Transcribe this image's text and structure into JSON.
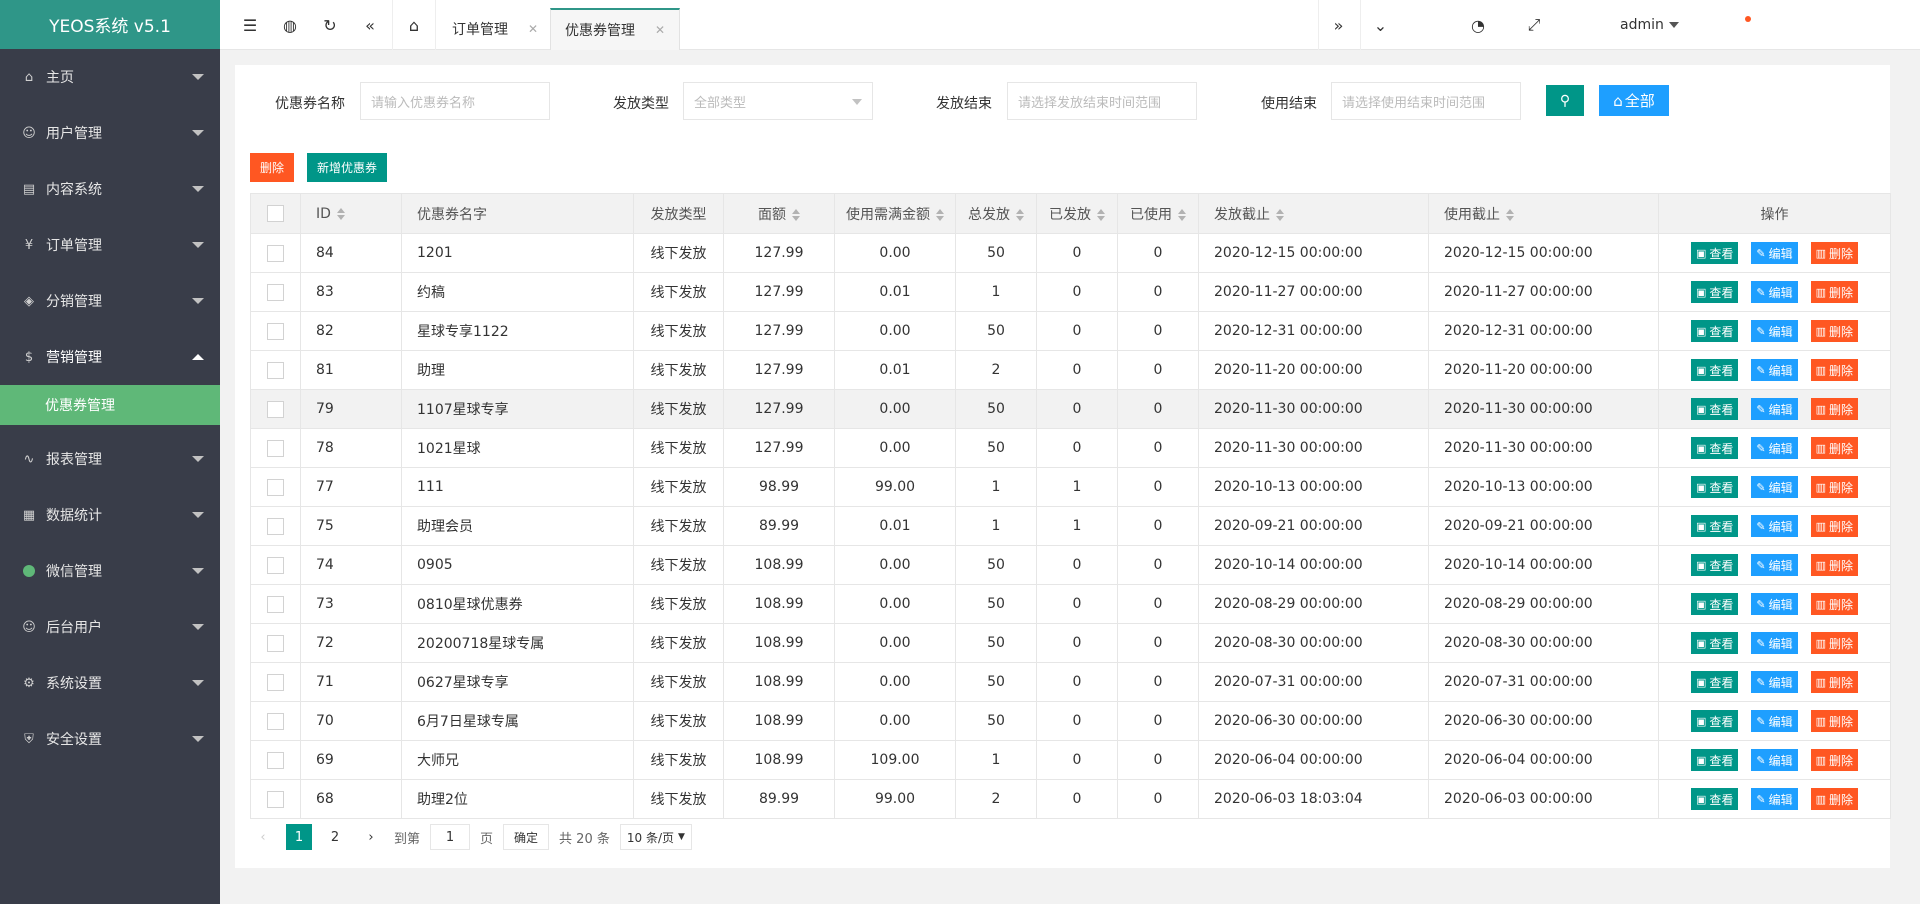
{
  "app": {
    "title": "YEOS系统 v5.1"
  },
  "sidebar": {
    "items": [
      {
        "label": "主页",
        "icon": "home-icon"
      },
      {
        "label": "用户管理",
        "icon": "user-icon"
      },
      {
        "label": "内容系统",
        "icon": "content-icon"
      },
      {
        "label": "订单管理",
        "icon": "yen-icon"
      },
      {
        "label": "分销管理",
        "icon": "cube-icon"
      },
      {
        "label": "营销管理",
        "icon": "dollar-icon"
      },
      {
        "label": "报表管理",
        "icon": "pulse-icon"
      },
      {
        "label": "数据统计",
        "icon": "table-icon"
      },
      {
        "label": "微信管理",
        "icon": "wechat-icon"
      },
      {
        "label": "后台用户",
        "icon": "admin-user-icon"
      },
      {
        "label": "系统设置",
        "icon": "gear-icon"
      },
      {
        "label": "安全设置",
        "icon": "shield-icon"
      }
    ],
    "sub_active": "优惠券管理"
  },
  "header": {
    "tabs": [
      {
        "label": "订单管理"
      },
      {
        "label": "优惠券管理"
      }
    ],
    "user": "admin"
  },
  "filters": {
    "name_label": "优惠券名称",
    "name_placeholder": "请输入优惠券名称",
    "type_label": "发放类型",
    "type_value": "全部类型",
    "issue_end_label": "发放结束",
    "issue_end_placeholder": "请选择发放结束时间范围",
    "use_end_label": "使用结束",
    "use_end_placeholder": "请选择使用结束时间范围",
    "all_label": "全部"
  },
  "actions": {
    "delete": "删除",
    "add": "新增优惠券"
  },
  "table": {
    "headers": [
      "ID",
      "优惠券名字",
      "发放类型",
      "面额",
      "使用需满金额",
      "总发放",
      "已发放",
      "已使用",
      "发放截止",
      "使用截止",
      "操作"
    ],
    "row_actions": {
      "view": "查看",
      "edit": "编辑",
      "delete": "删除"
    },
    "rows": [
      [
        "84",
        "1201",
        "线下发放",
        "127.99",
        "0.00",
        "50",
        "0",
        "0",
        "2020-12-15 00:00:00",
        "2020-12-15 00:00:00"
      ],
      [
        "83",
        "约稿",
        "线下发放",
        "127.99",
        "0.01",
        "1",
        "0",
        "0",
        "2020-11-27 00:00:00",
        "2020-11-27 00:00:00"
      ],
      [
        "82",
        "星球专享1122",
        "线下发放",
        "127.99",
        "0.00",
        "50",
        "0",
        "0",
        "2020-12-31 00:00:00",
        "2020-12-31 00:00:00"
      ],
      [
        "81",
        "助理",
        "线下发放",
        "127.99",
        "0.01",
        "2",
        "0",
        "0",
        "2020-11-20 00:00:00",
        "2020-11-20 00:00:00"
      ],
      [
        "79",
        "1107星球专享",
        "线下发放",
        "127.99",
        "0.00",
        "50",
        "0",
        "0",
        "2020-11-30 00:00:00",
        "2020-11-30 00:00:00"
      ],
      [
        "78",
        "1021星球",
        "线下发放",
        "127.99",
        "0.00",
        "50",
        "0",
        "0",
        "2020-11-30 00:00:00",
        "2020-11-30 00:00:00"
      ],
      [
        "77",
        "111",
        "线下发放",
        "98.99",
        "99.00",
        "1",
        "1",
        "0",
        "2020-10-13 00:00:00",
        "2020-10-13 00:00:00"
      ],
      [
        "75",
        "助理会员",
        "线下发放",
        "89.99",
        "0.01",
        "1",
        "1",
        "0",
        "2020-09-21 00:00:00",
        "2020-09-21 00:00:00"
      ],
      [
        "74",
        "0905",
        "线下发放",
        "108.99",
        "0.00",
        "50",
        "0",
        "0",
        "2020-10-14 00:00:00",
        "2020-10-14 00:00:00"
      ],
      [
        "73",
        "0810星球优惠券",
        "线下发放",
        "108.99",
        "0.00",
        "50",
        "0",
        "0",
        "2020-08-29 00:00:00",
        "2020-08-29 00:00:00"
      ],
      [
        "72",
        "20200718星球专属",
        "线下发放",
        "108.99",
        "0.00",
        "50",
        "0",
        "0",
        "2020-08-30 00:00:00",
        "2020-08-30 00:00:00"
      ],
      [
        "71",
        "0627星球专享",
        "线下发放",
        "108.99",
        "0.00",
        "50",
        "0",
        "0",
        "2020-07-31 00:00:00",
        "2020-07-31 00:00:00"
      ],
      [
        "70",
        "6月7日星球专属",
        "线下发放",
        "108.99",
        "0.00",
        "50",
        "0",
        "0",
        "2020-06-30 00:00:00",
        "2020-06-30 00:00:00"
      ],
      [
        "69",
        "大师兄",
        "线下发放",
        "108.99",
        "109.00",
        "1",
        "0",
        "0",
        "2020-06-04 00:00:00",
        "2020-06-04 00:00:00"
      ],
      [
        "68",
        "助理2位",
        "线下发放",
        "89.99",
        "99.00",
        "2",
        "0",
        "0",
        "2020-06-03 18:03:04",
        "2020-06-03 00:00:00"
      ]
    ]
  },
  "pagination": {
    "pages": [
      "1",
      "2"
    ],
    "goto_label": "到第",
    "goto_value": "1",
    "page_unit": "页",
    "confirm": "确定",
    "total": "共 20 条",
    "page_size": "10 条/页"
  },
  "colors": {
    "primary": "#009688",
    "blue": "#1e9fff",
    "danger": "#ff5722",
    "sidebar": "#393d49",
    "submenu": "#5fb878"
  }
}
